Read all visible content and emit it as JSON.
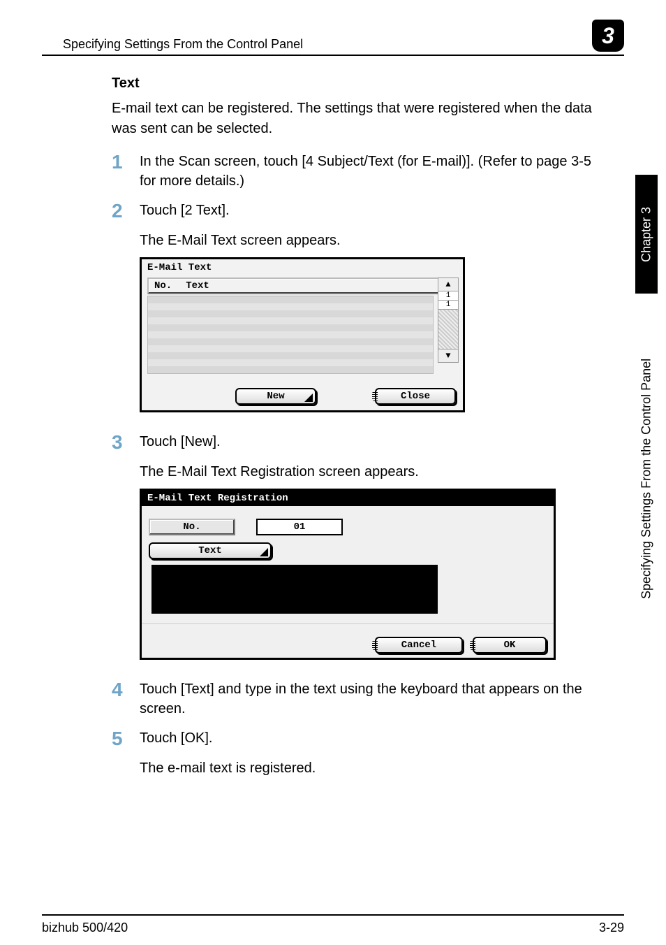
{
  "header": {
    "title": "Specifying Settings From the Control Panel",
    "chapter_badge": "3"
  },
  "side_tabs": {
    "dark": "Chapter 3",
    "light": "Specifying Settings From the Control Panel"
  },
  "section": {
    "heading": "Text",
    "intro": "E-mail text can be registered. The settings that were registered when the data was sent can be selected."
  },
  "steps": {
    "s1": {
      "num": "1",
      "text": "In the Scan screen, touch [4 Subject/Text (for E-mail)]. (Refer to page 3-5 for more details.)"
    },
    "s2": {
      "num": "2",
      "text": "Touch [2 Text].",
      "sub": "The E-Mail Text screen appears."
    },
    "s3": {
      "num": "3",
      "text": "Touch [New].",
      "sub": "The E-Mail Text Registration screen appears."
    },
    "s4": {
      "num": "4",
      "text": "Touch [Text] and type in the text using the keyboard that appears on the screen."
    },
    "s5": {
      "num": "5",
      "text": "Touch [OK].",
      "sub": "The e-mail text is registered."
    }
  },
  "screenshot1": {
    "title": "E-Mail Text",
    "col_no": "No.",
    "col_text": "Text",
    "page_top": "1",
    "page_bot": "1",
    "btn_new": "New",
    "btn_close": "Close"
  },
  "screenshot2": {
    "title": "E-Mail Text Registration",
    "no_label": "No.",
    "no_value": "01",
    "text_label": "Text",
    "btn_cancel": "Cancel",
    "btn_ok": "OK"
  },
  "footer": {
    "left": "bizhub 500/420",
    "right": "3-29"
  }
}
